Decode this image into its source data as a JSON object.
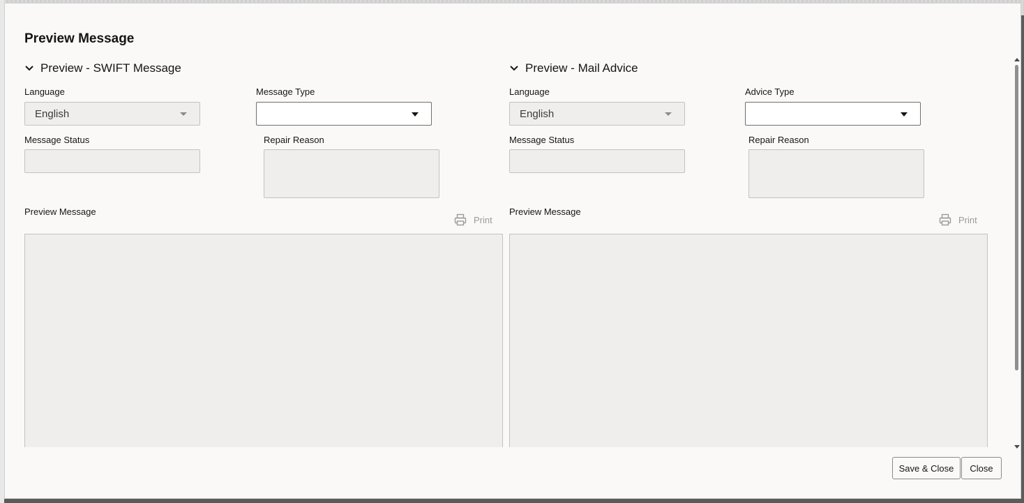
{
  "dialog": {
    "title": "Preview Message",
    "save_close_label": "Save & Close",
    "close_label": "Close"
  },
  "swift": {
    "section_title": "Preview - SWIFT Message",
    "language_label": "Language",
    "language_value": "English",
    "type_label": "Message Type",
    "type_value": "",
    "status_label": "Message Status",
    "status_value": "",
    "repair_label": "Repair Reason",
    "repair_value": "",
    "preview_label": "Preview Message",
    "print_label": "Print",
    "preview_value": ""
  },
  "mail": {
    "section_title": "Preview - Mail Advice",
    "language_label": "Language",
    "language_value": "English",
    "type_label": "Advice Type",
    "type_value": "",
    "status_label": "Message Status",
    "status_value": "",
    "repair_label": "Repair Reason",
    "repair_value": "",
    "preview_label": "Preview Message",
    "print_label": "Print",
    "preview_value": ""
  },
  "icons": {
    "collapse": "chevron-down-icon",
    "print": "printer-icon",
    "dropdown": "caret-down-icon"
  },
  "colors": {
    "dialog_bg": "#fbf9f8",
    "field_readonly_bg": "#efeeec",
    "text": "#161513",
    "muted": "#9c9a97"
  }
}
